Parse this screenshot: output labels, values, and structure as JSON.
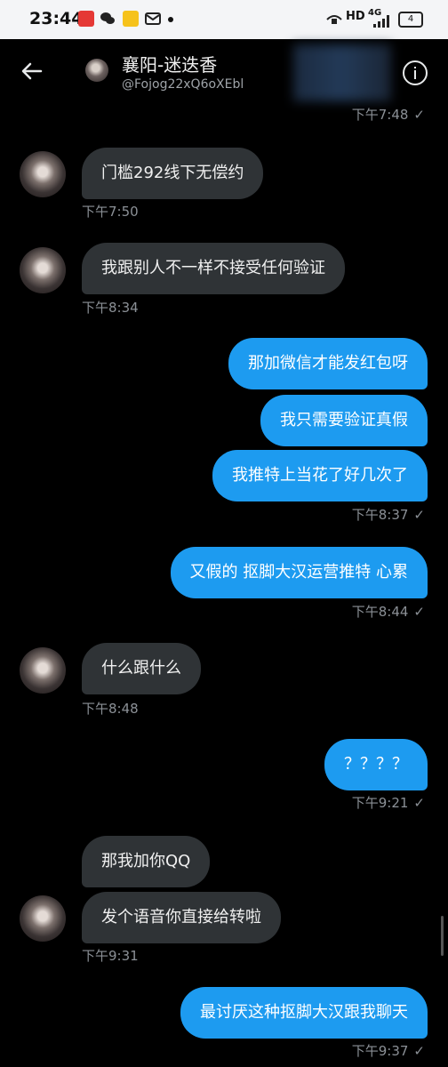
{
  "status_bar": {
    "time": "23:44",
    "network": "HD",
    "signal": "4G",
    "battery": "4"
  },
  "header": {
    "name": "襄阳-迷迭香",
    "handle": "@Fojog22xQ6oXEbl"
  },
  "messages": [
    {
      "type": "time_out",
      "time": "下午7:48",
      "check": "✓"
    },
    {
      "type": "in",
      "text": "门槛292线下无偿约",
      "time": "下午7:50"
    },
    {
      "type": "in",
      "text": "我跟别人不一样不接受任何验证",
      "time": "下午8:34"
    },
    {
      "type": "out",
      "text": "那加微信才能发红包呀"
    },
    {
      "type": "out",
      "text": "我只需要验证真假"
    },
    {
      "type": "out",
      "text": "我推特上当花了好几次了",
      "time": "下午8:37",
      "check": "✓"
    },
    {
      "type": "out",
      "text": "又假的 抠脚大汉运营推特 心累",
      "time": "下午8:44",
      "check": "✓"
    },
    {
      "type": "in",
      "text": "什么跟什么",
      "time": "下午8:48"
    },
    {
      "type": "out",
      "text": "？？？？",
      "time": "下午9:21",
      "check": "✓"
    },
    {
      "type": "in",
      "text": "那我加你QQ"
    },
    {
      "type": "in",
      "text": "发个语音你直接给转啦",
      "time": "下午9:31"
    },
    {
      "type": "out",
      "text": "最讨厌这种抠脚大汉跟我聊天",
      "time": "下午9:37",
      "check": "✓"
    }
  ]
}
